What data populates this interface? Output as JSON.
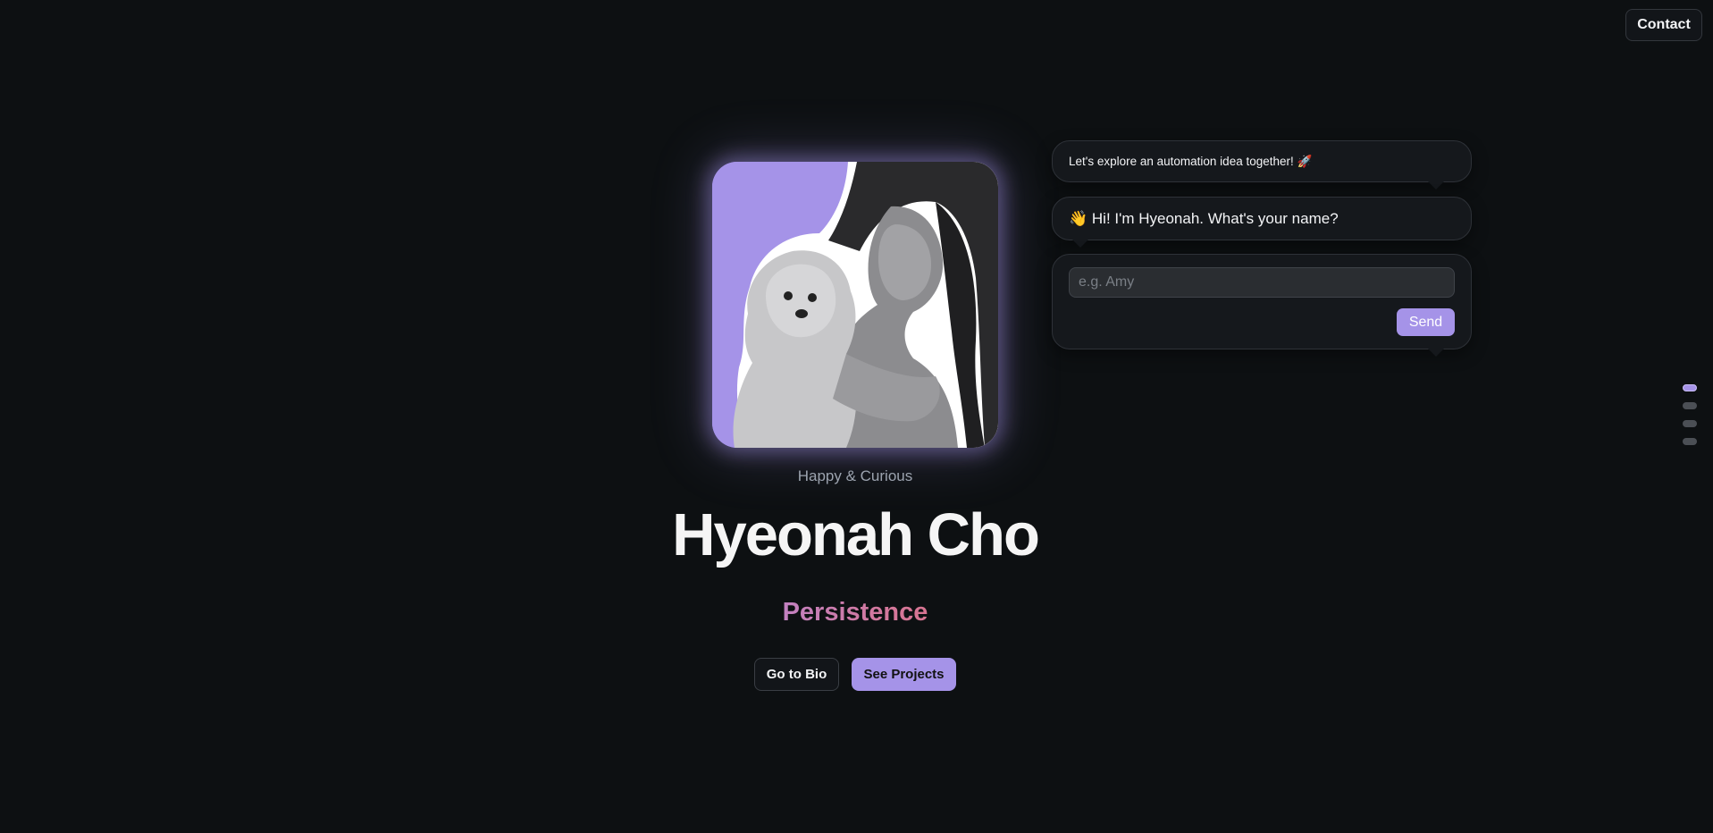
{
  "header": {
    "contact_label": "Contact"
  },
  "hero": {
    "tagline": "Happy & Curious",
    "name": "Hyeonah Cho",
    "trait": "Persistence",
    "bio_button": "Go to Bio",
    "projects_button": "See Projects"
  },
  "chat": {
    "message_1": "Let's explore an automation idea together! 🚀",
    "message_2": "👋 Hi! I'm Hyeonah. What's your name?",
    "input_placeholder": "e.g. Amy",
    "input_value": "",
    "send_label": "Send"
  },
  "pager": {
    "sections": 4,
    "active_index": 0
  },
  "colors": {
    "background": "#0d1012",
    "accent": "#a593e8",
    "trait_gradient_start": "#b08be6",
    "trait_gradient_end": "#e06c78"
  },
  "icons": {
    "photo": "portrait-with-dog-image"
  }
}
